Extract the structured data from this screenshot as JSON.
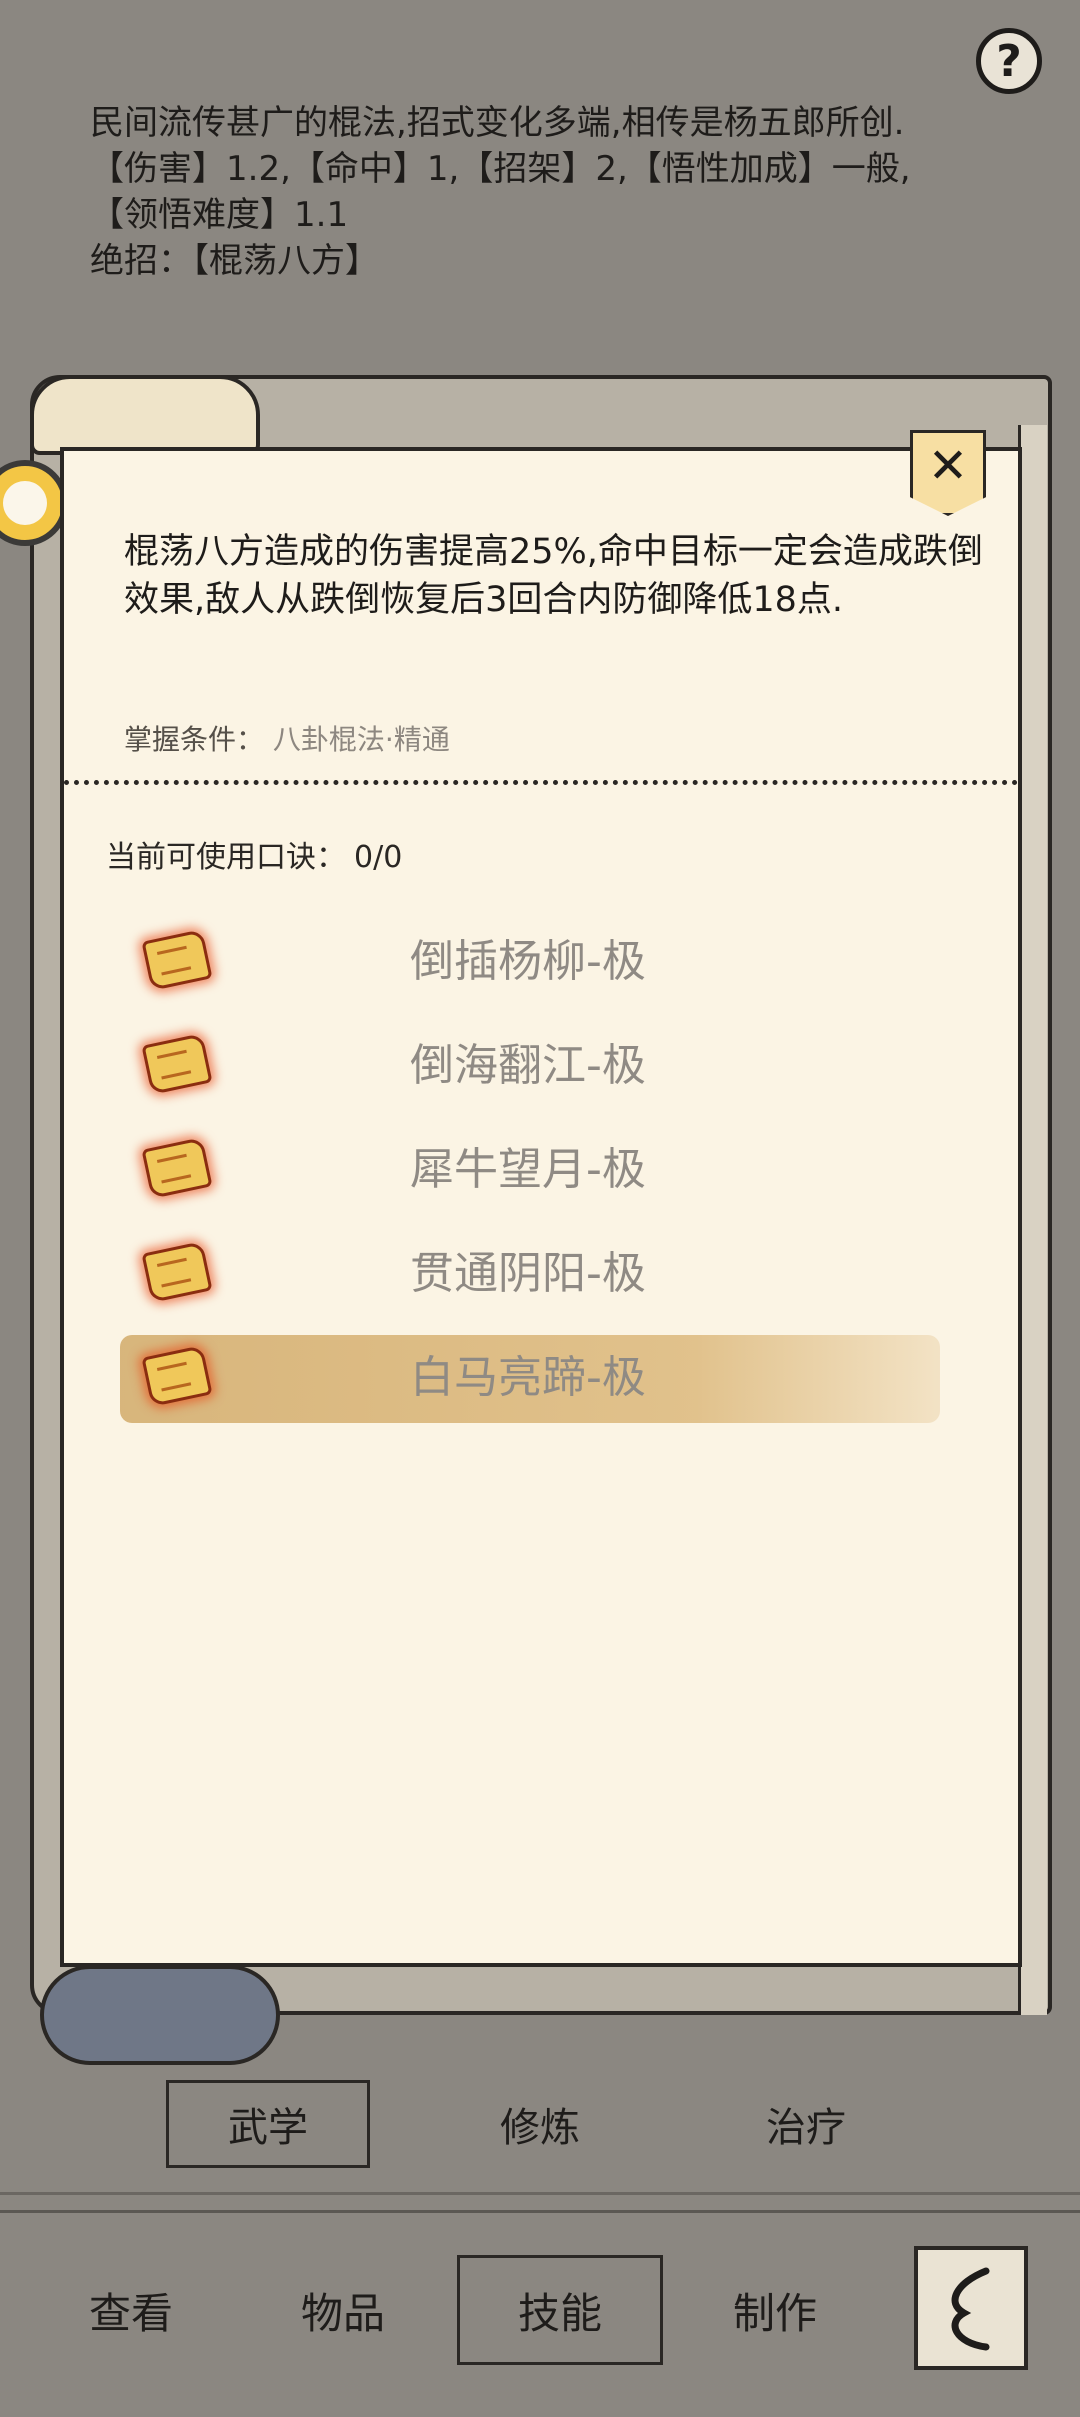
{
  "help_label": "?",
  "description": {
    "line1": "民间流传甚广的棍法,招式变化多端,相传是杨五郎所创.",
    "line2": "【伤害】1.2,【命中】1,【招架】2,【悟性加成】一般,",
    "line3": "【领悟难度】1.1",
    "line4": "绝招：【棍荡八方】"
  },
  "dialog": {
    "close_label": "✕",
    "effect_text": "棍荡八方造成的伤害提高25%,命中目标一定会造成跌倒效果,敌人从跌倒恢复后3回合内防御降低18点.",
    "condition_label": "掌握条件：",
    "condition_value": "八卦棍法·精通",
    "usable_label": "当前可使用口诀：",
    "usable_count": "0/0",
    "items": [
      {
        "label": "倒插杨柳-极",
        "icon": "scroll-icon",
        "selected": false
      },
      {
        "label": "倒海翻江-极",
        "icon": "scroll-icon",
        "selected": false
      },
      {
        "label": "犀牛望月-极",
        "icon": "scroll-icon",
        "selected": false
      },
      {
        "label": "贯通阴阳-极",
        "icon": "scroll-icon",
        "selected": false
      },
      {
        "label": "白马亮蹄-极",
        "icon": "scroll-icon",
        "selected": true
      }
    ]
  },
  "sub_tabs": [
    {
      "label": "武学",
      "active": true
    },
    {
      "label": "修炼",
      "active": false
    },
    {
      "label": "治疗",
      "active": false
    }
  ],
  "bottom_nav": [
    {
      "label": "查看",
      "active": false
    },
    {
      "label": "物品",
      "active": false
    },
    {
      "label": "技能",
      "active": true
    },
    {
      "label": "制作",
      "active": false
    }
  ],
  "back_icon": "back-arrow-icon"
}
